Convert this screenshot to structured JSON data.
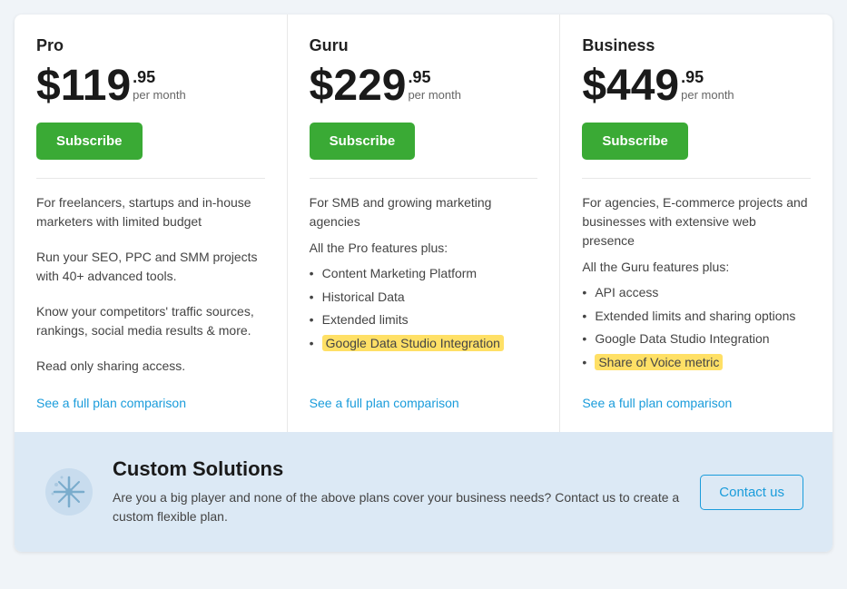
{
  "plans": [
    {
      "id": "pro",
      "name": "Pro",
      "price_main": "$119",
      "price_cents": ".95",
      "price_period": "per month",
      "subscribe_label": "Subscribe",
      "descriptions": [
        "For freelancers, startups and in-house marketers with limited budget",
        "Run your SEO, PPC and SMM projects with 40+ advanced tools.",
        "Know your competitors' traffic sources, rankings, social media results & more.",
        "Read only sharing access."
      ],
      "features_header": null,
      "features": [],
      "see_plan_label": "See a full plan comparison"
    },
    {
      "id": "guru",
      "name": "Guru",
      "price_main": "$229",
      "price_cents": ".95",
      "price_period": "per month",
      "subscribe_label": "Subscribe",
      "descriptions": [
        "For SMB and growing marketing agencies",
        "All the Pro features plus:"
      ],
      "features_header": "All the Pro features plus:",
      "features": [
        {
          "text": "Content Marketing Platform",
          "highlight": false
        },
        {
          "text": "Historical Data",
          "highlight": false
        },
        {
          "text": "Extended limits",
          "highlight": false
        },
        {
          "text": "Google Data Studio Integration",
          "highlight": true
        }
      ],
      "see_plan_label": "See a full plan comparison"
    },
    {
      "id": "business",
      "name": "Business",
      "price_main": "$449",
      "price_cents": ".95",
      "price_period": "per month",
      "subscribe_label": "Subscribe",
      "descriptions": [
        "For agencies, E-commerce projects and businesses with extensive web presence",
        "All the Guru features plus:"
      ],
      "features_header": "All the Guru features plus:",
      "features": [
        {
          "text": "API access",
          "highlight": false
        },
        {
          "text": "Extended limits and sharing options",
          "highlight": false
        },
        {
          "text": "Google Data Studio Integration",
          "highlight": false
        },
        {
          "text": "Share of Voice metric",
          "highlight": true
        }
      ],
      "see_plan_label": "See a full plan comparison"
    }
  ],
  "custom_solutions": {
    "title": "Custom Solutions",
    "description": "Are you a big player and none of the above plans cover your business needs? Contact us to create a custom flexible plan.",
    "contact_label": "Contact us"
  }
}
